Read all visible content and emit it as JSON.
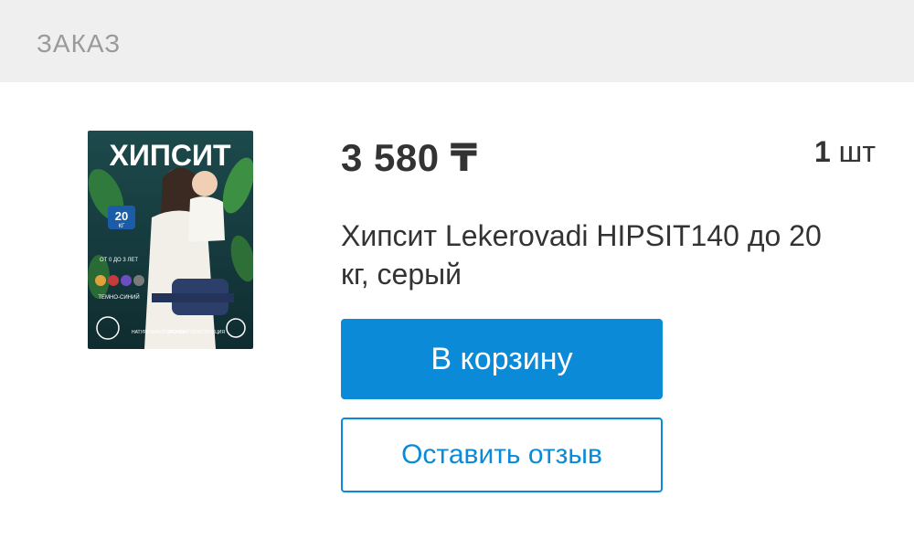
{
  "section": {
    "title": "ЗАКАЗ"
  },
  "product": {
    "image_name": "hipseat-product-photo",
    "image_text": {
      "headline": "ХИПСИТ",
      "badge_value": "20",
      "badge_unit": "КГ",
      "age": "ОТ 0 ДО 3 ЛЕТ",
      "color": "ТЕМНО-СИНИЙ",
      "feature_left": "НАТУРАЛЬНЫЙ ХЛОПОК",
      "feature_right": "ПРОЧНЫЙ КОНСТРУКЦИЯ"
    },
    "price": "3 580 ₸",
    "quantity": {
      "value": "1",
      "unit": "шт"
    },
    "title": "Хипсит Lekerovadi HIPSIT140 до 20 кг, серый"
  },
  "actions": {
    "add_to_cart": "В корзину",
    "leave_review": "Оставить отзыв"
  },
  "colors": {
    "accent": "#0b8ad8",
    "header_bg": "#efefef",
    "text": "#333333",
    "muted": "#9a9a9a"
  }
}
